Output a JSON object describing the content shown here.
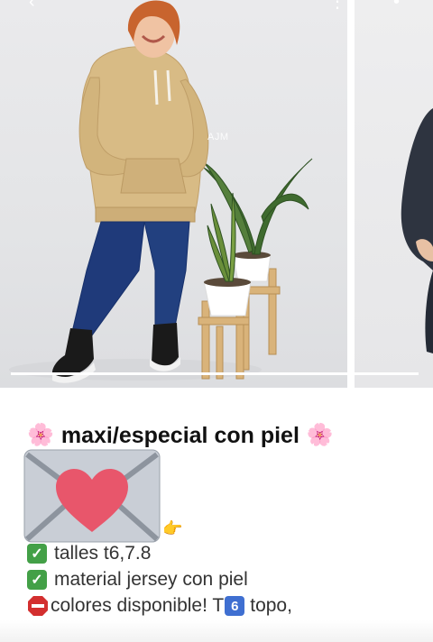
{
  "carousel": {
    "watermark": "AJM",
    "slide_count": 2,
    "progress_fraction": 1.0
  },
  "post": {
    "title_emoji_left": "🌸",
    "title": "maxi/especial con piel",
    "title_emoji_right": "🌸",
    "pointer_emoji": "👉",
    "lines": [
      {
        "icon": "check-icon",
        "text": "talles t6,7.8"
      },
      {
        "icon": "check-icon",
        "text": "material jersey con piel"
      },
      {
        "icon": "stop-sign-icon",
        "text_before": "colores disponible! T",
        "keycap": "6",
        "text_after": " topo,"
      }
    ]
  },
  "colors": {
    "check": "#43a047",
    "stop": "#d32f2f",
    "heart": "#e8566b",
    "envelope": "#c9ced6",
    "keycap": "#3f6fd1"
  }
}
